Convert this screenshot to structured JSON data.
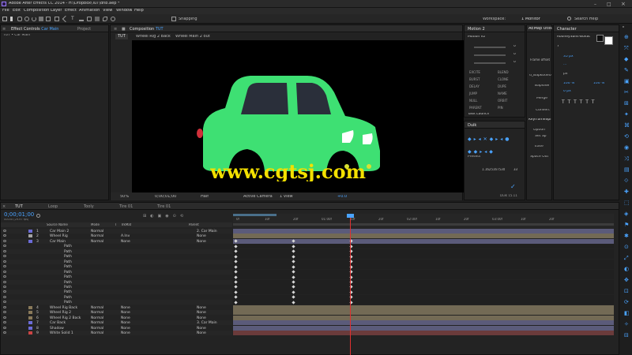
{
  "app": {
    "title": "Adobe After Effects CC 2014 - H:\\Dropbox\\TuT\\dnb.aep *",
    "menu": [
      "File",
      "Edit",
      "Composition",
      "Layer",
      "Effect",
      "Animation",
      "View",
      "Window",
      "Help"
    ],
    "toolbar": {
      "snapping_label": "Snapping",
      "workspace_label": "Workspace:",
      "workspace_value": "1 Monitor",
      "search_placeholder": "Search Help"
    }
  },
  "effect_controls": {
    "tab_label": "Effect Controls",
    "tab_target": "Car Main",
    "project_tab": "Project",
    "breadcrumb": "TUT • Car Main"
  },
  "composition": {
    "tab_label": "Composition",
    "tab_target": "TUT",
    "subtabs": [
      "TUT",
      "Wheel Rig 2 Back",
      "Wheel Main 2 out"
    ],
    "footer": {
      "zoom": "50%",
      "timecode": "0;00;01;00",
      "resolution": "Half",
      "camera": "Active Camera",
      "views": "1 View",
      "exposure": "+0.0"
    },
    "watermark": "www.cgtsj.com"
  },
  "motion2": {
    "tab_label": "Motion 2",
    "preset": "Motion v2",
    "sliders": [
      "0",
      "0",
      "0"
    ],
    "buttons": [
      "EXCITE",
      "BLEND",
      "BURST",
      "CLONE",
      "DELAY",
      "DUPE",
      "JUMP",
      "NAME",
      "NULL",
      "ORBIT",
      "PARENT",
      "PIN",
      "ROPE",
      "SORT",
      "SPIN",
      "STARE"
    ],
    "task_launch": "Task Launch"
  },
  "aemap": {
    "tab_label": "AEMap Utils",
    "frame_offset": "Frame offset",
    "items": [
      "d_BapkodeU",
      "Baplode",
      "Merge",
      "Convert"
    ],
    "keyframe_tab": "KeyframeSpi",
    "options": "Option",
    "set_sp": "Set Sp",
    "ease": "Ease",
    "space_out": "Space Out"
  },
  "character": {
    "tab_label": "Character",
    "font_name": "RooneySans-BoldIt",
    "font_size": "7",
    "tracking": "...",
    "leading": "35 px",
    "vert_scale": "100 %",
    "horiz_scale": "100 %",
    "baseline": "0 px",
    "px_label": "px"
  },
  "duik": {
    "tab_label": "Duik",
    "presets_label": "Presets",
    "value": "1.1625167530",
    "value2": "33",
    "status": "Duik 15.11"
  },
  "right_dock": {
    "tab_label": "Tr"
  },
  "timeline": {
    "tabs": [
      "TUT",
      "Loop",
      "Tooly",
      "Tire 01",
      "Tire 01"
    ],
    "timecode": "0;00;01;00",
    "fps": "00030 (29.97 fps)",
    "columns": [
      "Source Name",
      "Mode",
      "T",
      "TrkMat",
      "Parent"
    ],
    "ruler": [
      "0f",
      "10f",
      "20f",
      "01:00f",
      "10f",
      "20f",
      "02:00f",
      "10f",
      "20f",
      "03:00f",
      "10f",
      "20f"
    ],
    "layers": [
      {
        "num": "1",
        "name": "Car Main 2",
        "mode": "Normal",
        "trk": "",
        "parent": "2. Car Main",
        "color": "#6c6cd8",
        "kind": "solid"
      },
      {
        "num": "2",
        "name": "Wheel Rig",
        "mode": "Normal",
        "trk": "A.Inv",
        "parent": "None",
        "color": "#a4a4a4",
        "kind": "comp"
      },
      {
        "num": "3",
        "name": "Car Main",
        "mode": "Normal",
        "trk": "None",
        "parent": "None",
        "color": "#6c6cd8",
        "kind": "shape"
      },
      {
        "num": "",
        "name": "Path",
        "mode": "",
        "trk": "",
        "parent": "",
        "color": "",
        "kind": "path"
      },
      {
        "num": "",
        "name": "Path",
        "mode": "",
        "trk": "",
        "parent": "",
        "color": "",
        "kind": "path"
      },
      {
        "num": "",
        "name": "Path",
        "mode": "",
        "trk": "",
        "parent": "",
        "color": "",
        "kind": "path"
      },
      {
        "num": "",
        "name": "Path",
        "mode": "",
        "trk": "",
        "parent": "",
        "color": "",
        "kind": "path"
      },
      {
        "num": "",
        "name": "Path",
        "mode": "",
        "trk": "",
        "parent": "",
        "color": "",
        "kind": "path"
      },
      {
        "num": "",
        "name": "Path",
        "mode": "",
        "trk": "",
        "parent": "",
        "color": "",
        "kind": "path"
      },
      {
        "num": "",
        "name": "Path",
        "mode": "",
        "trk": "",
        "parent": "",
        "color": "",
        "kind": "path"
      },
      {
        "num": "",
        "name": "Path",
        "mode": "",
        "trk": "",
        "parent": "",
        "color": "",
        "kind": "path"
      },
      {
        "num": "",
        "name": "Path",
        "mode": "",
        "trk": "",
        "parent": "",
        "color": "",
        "kind": "path"
      },
      {
        "num": "",
        "name": "Path",
        "mode": "",
        "trk": "",
        "parent": "",
        "color": "",
        "kind": "path"
      },
      {
        "num": "",
        "name": "Path",
        "mode": "",
        "trk": "",
        "parent": "",
        "color": "",
        "kind": "path"
      },
      {
        "num": "",
        "name": "Path",
        "mode": "",
        "trk": "",
        "parent": "",
        "color": "",
        "kind": "path"
      },
      {
        "num": "4",
        "name": "Wheel Rig Back",
        "mode": "Normal",
        "trk": "None",
        "parent": "None",
        "color": "#8a7a5a",
        "kind": "comp"
      },
      {
        "num": "5",
        "name": "Wheel Rig 2",
        "mode": "Normal",
        "trk": "None",
        "parent": "None",
        "color": "#8a7a5a",
        "kind": "comp"
      },
      {
        "num": "6",
        "name": "Wheel Rig 2 Back",
        "mode": "Normal",
        "trk": "None",
        "parent": "None",
        "color": "#8a7a5a",
        "kind": "comp"
      },
      {
        "num": "7",
        "name": "Car Back",
        "mode": "Normal",
        "trk": "None",
        "parent": "3. Car Main",
        "color": "#6c6cd8",
        "kind": "shape"
      },
      {
        "num": "8",
        "name": "Shadow",
        "mode": "Normal",
        "trk": "None",
        "parent": "None",
        "color": "#6c6cd8",
        "kind": "shape"
      },
      {
        "num": "9",
        "name": "White Solid 1",
        "mode": "Normal",
        "trk": "None",
        "parent": "None",
        "color": "#c44",
        "kind": "solid"
      }
    ]
  },
  "colors": {
    "accent": "#4aa3ff",
    "car_body": "#3ee073",
    "car_window": "#2a2f3a",
    "playhead": "#e03030",
    "watermark": "#f3e000"
  }
}
